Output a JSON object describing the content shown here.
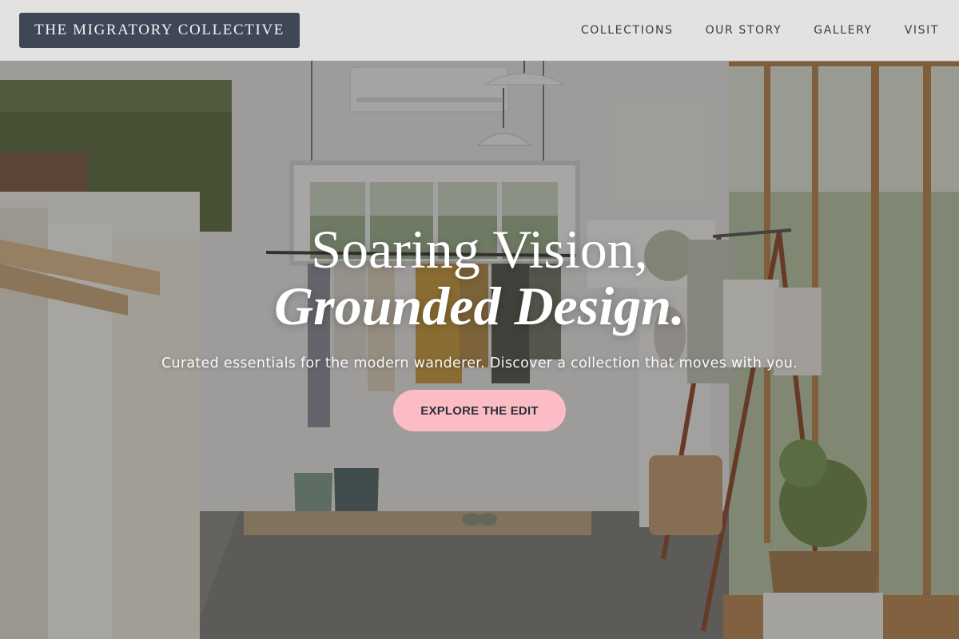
{
  "header": {
    "logo_text": "THE MIGRATORY COLLECTIVE",
    "nav": [
      {
        "label": "COLLECTIONS"
      },
      {
        "label": "OUR STORY"
      },
      {
        "label": "GALLERY"
      },
      {
        "label": "VISIT"
      }
    ]
  },
  "hero": {
    "headline_line1": "Soaring Vision,",
    "headline_line2": "Grounded Design.",
    "tagline": "Curated essentials for the modern wanderer. Discover a collection that moves with you.",
    "cta_label": "EXPLORE THE EDIT",
    "background_image": "boutique-interior-photo"
  },
  "colors": {
    "logo_bg": "#3f4656",
    "cta_bg": "#fbbcc5",
    "nav_text": "#3a3d47",
    "header_bg": "#e8e7e5"
  }
}
